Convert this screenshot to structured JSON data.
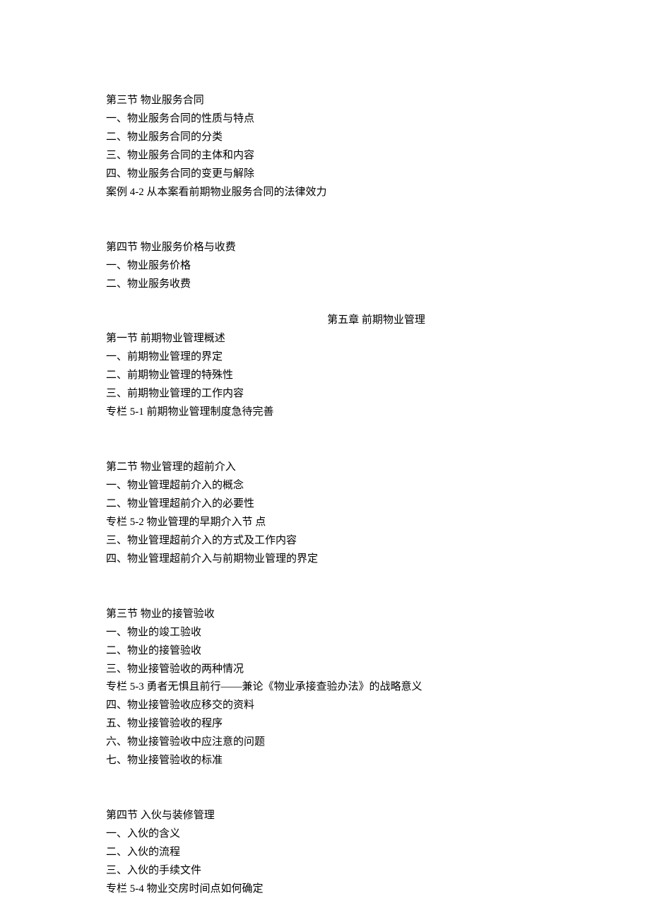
{
  "section3": {
    "heading": "第三节 物业服务合同",
    "items": [
      "一、物业服务合同的性质与特点",
      "二、物业服务合同的分类",
      "三、物业服务合同的主体和内容",
      "四、物业服务合同的变更与解除",
      "案例 4-2 从本案看前期物业服务合同的法律效力"
    ]
  },
  "section4": {
    "heading": "第四节 物业服务价格与收费",
    "items": [
      "一、物业服务价格",
      "二、物业服务收费"
    ]
  },
  "chapter5": {
    "title": "第五章 前期物业管理"
  },
  "ch5_section1": {
    "heading": "第一节 前期物业管理概述",
    "items": [
      "一、前期物业管理的界定",
      "二、前期物业管理的特殊性",
      "三、前期物业管理的工作内容",
      "专栏 5-1 前期物业管理制度急待完善"
    ]
  },
  "ch5_section2": {
    "heading": "第二节 物业管理的超前介入",
    "items": [
      "一、物业管理超前介入的概念",
      "二、物业管理超前介入的必要性",
      "专栏 5-2 物业管理的早期介入节 点",
      "三、物业管理超前介入的方式及工作内容",
      "四、物业管理超前介入与前期物业管理的界定"
    ]
  },
  "ch5_section3": {
    "heading": "第三节 物业的接管验收",
    "items": [
      "一、物业的竣工验收",
      "二、物业的接管验收",
      "三、物业接管验收的两种情况",
      "专栏 5-3 勇者无惧且前行——兼论《物业承接查验办法》的战略意义",
      "四、物业接管验收应移交的资料",
      "五、物业接管验收的程序",
      "六、物业接管验收中应注意的问题",
      "七、物业接管验收的标准"
    ]
  },
  "ch5_section4": {
    "heading": "第四节 入伙与装修管理",
    "items": [
      "一、入伙的含义",
      "二、入伙的流程",
      "三、入伙的手续文件",
      "专栏 5-4 物业交房时间点如何确定"
    ]
  }
}
